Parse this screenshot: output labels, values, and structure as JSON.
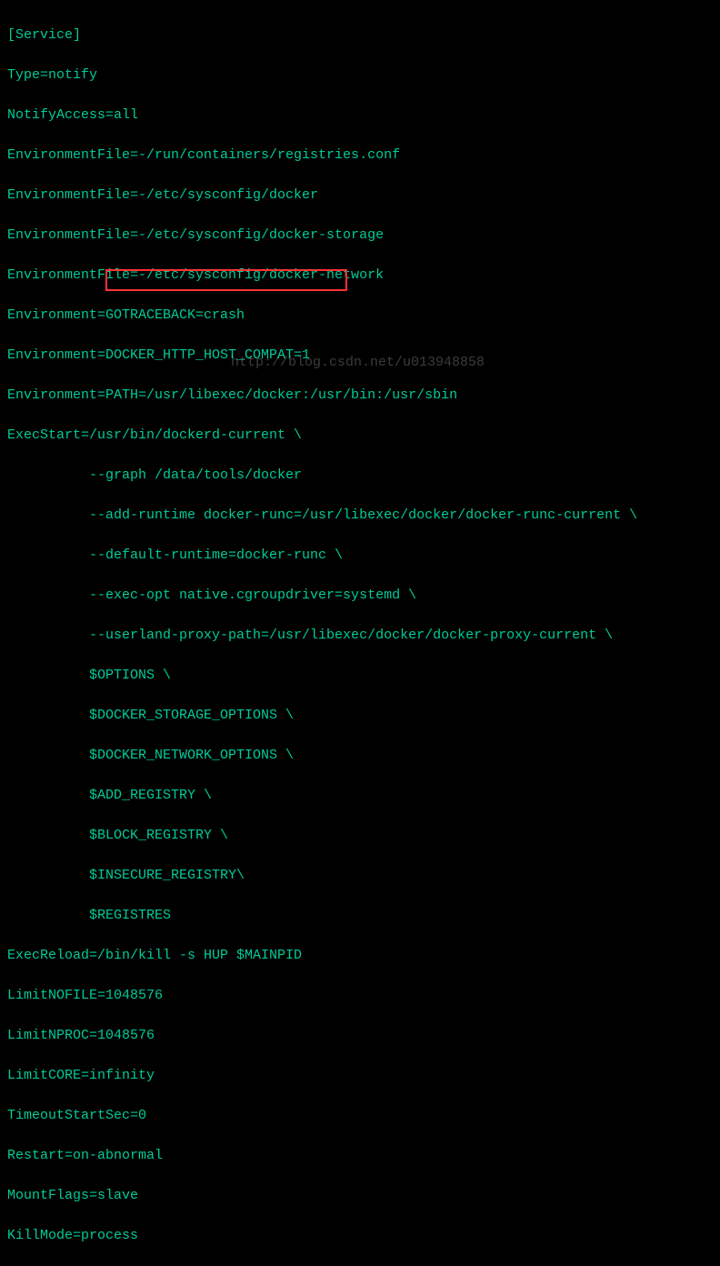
{
  "lines": {
    "l0": "[Service]",
    "l1": "Type=notify",
    "l2": "NotifyAccess=all",
    "l3": "EnvironmentFile=-/run/containers/registries.conf",
    "l4": "EnvironmentFile=-/etc/sysconfig/docker",
    "l5": "EnvironmentFile=-/etc/sysconfig/docker-storage",
    "l6": "EnvironmentFile=-/etc/sysconfig/docker-network",
    "l7": "Environment=GOTRACEBACK=crash",
    "l8": "Environment=DOCKER_HTTP_HOST_COMPAT=1",
    "l9": "Environment=PATH=/usr/libexec/docker:/usr/bin:/usr/sbin",
    "l10": "ExecStart=/usr/bin/dockerd-current \\",
    "l11": "          --graph /data/tools/docker",
    "l12": "          --add-runtime docker-runc=/usr/libexec/docker/docker-runc-current \\",
    "l13": "          --default-runtime=docker-runc \\",
    "l14": "          --exec-opt native.cgroupdriver=systemd \\",
    "l15": "          --userland-proxy-path=/usr/libexec/docker/docker-proxy-current \\",
    "l16": "          $OPTIONS \\",
    "l17": "          $DOCKER_STORAGE_OPTIONS \\",
    "l18": "          $DOCKER_NETWORK_OPTIONS \\",
    "l19": "          $ADD_REGISTRY \\",
    "l20": "          $BLOCK_REGISTRY \\",
    "l21": "          $INSECURE_REGISTRY\\",
    "l22": "          $REGISTRES",
    "l23": "ExecReload=/bin/kill -s HUP $MAINPID",
    "l24": "LimitNOFILE=1048576",
    "l25": "LimitNPROC=1048576",
    "l26": "LimitCORE=infinity",
    "l27": "TimeoutStartSec=0",
    "l28": "Restart=on-abnormal",
    "l29": "MountFlags=slave",
    "l30": "KillMode=process"
  },
  "watermark": "http://blog.csdn.net/u013948858"
}
